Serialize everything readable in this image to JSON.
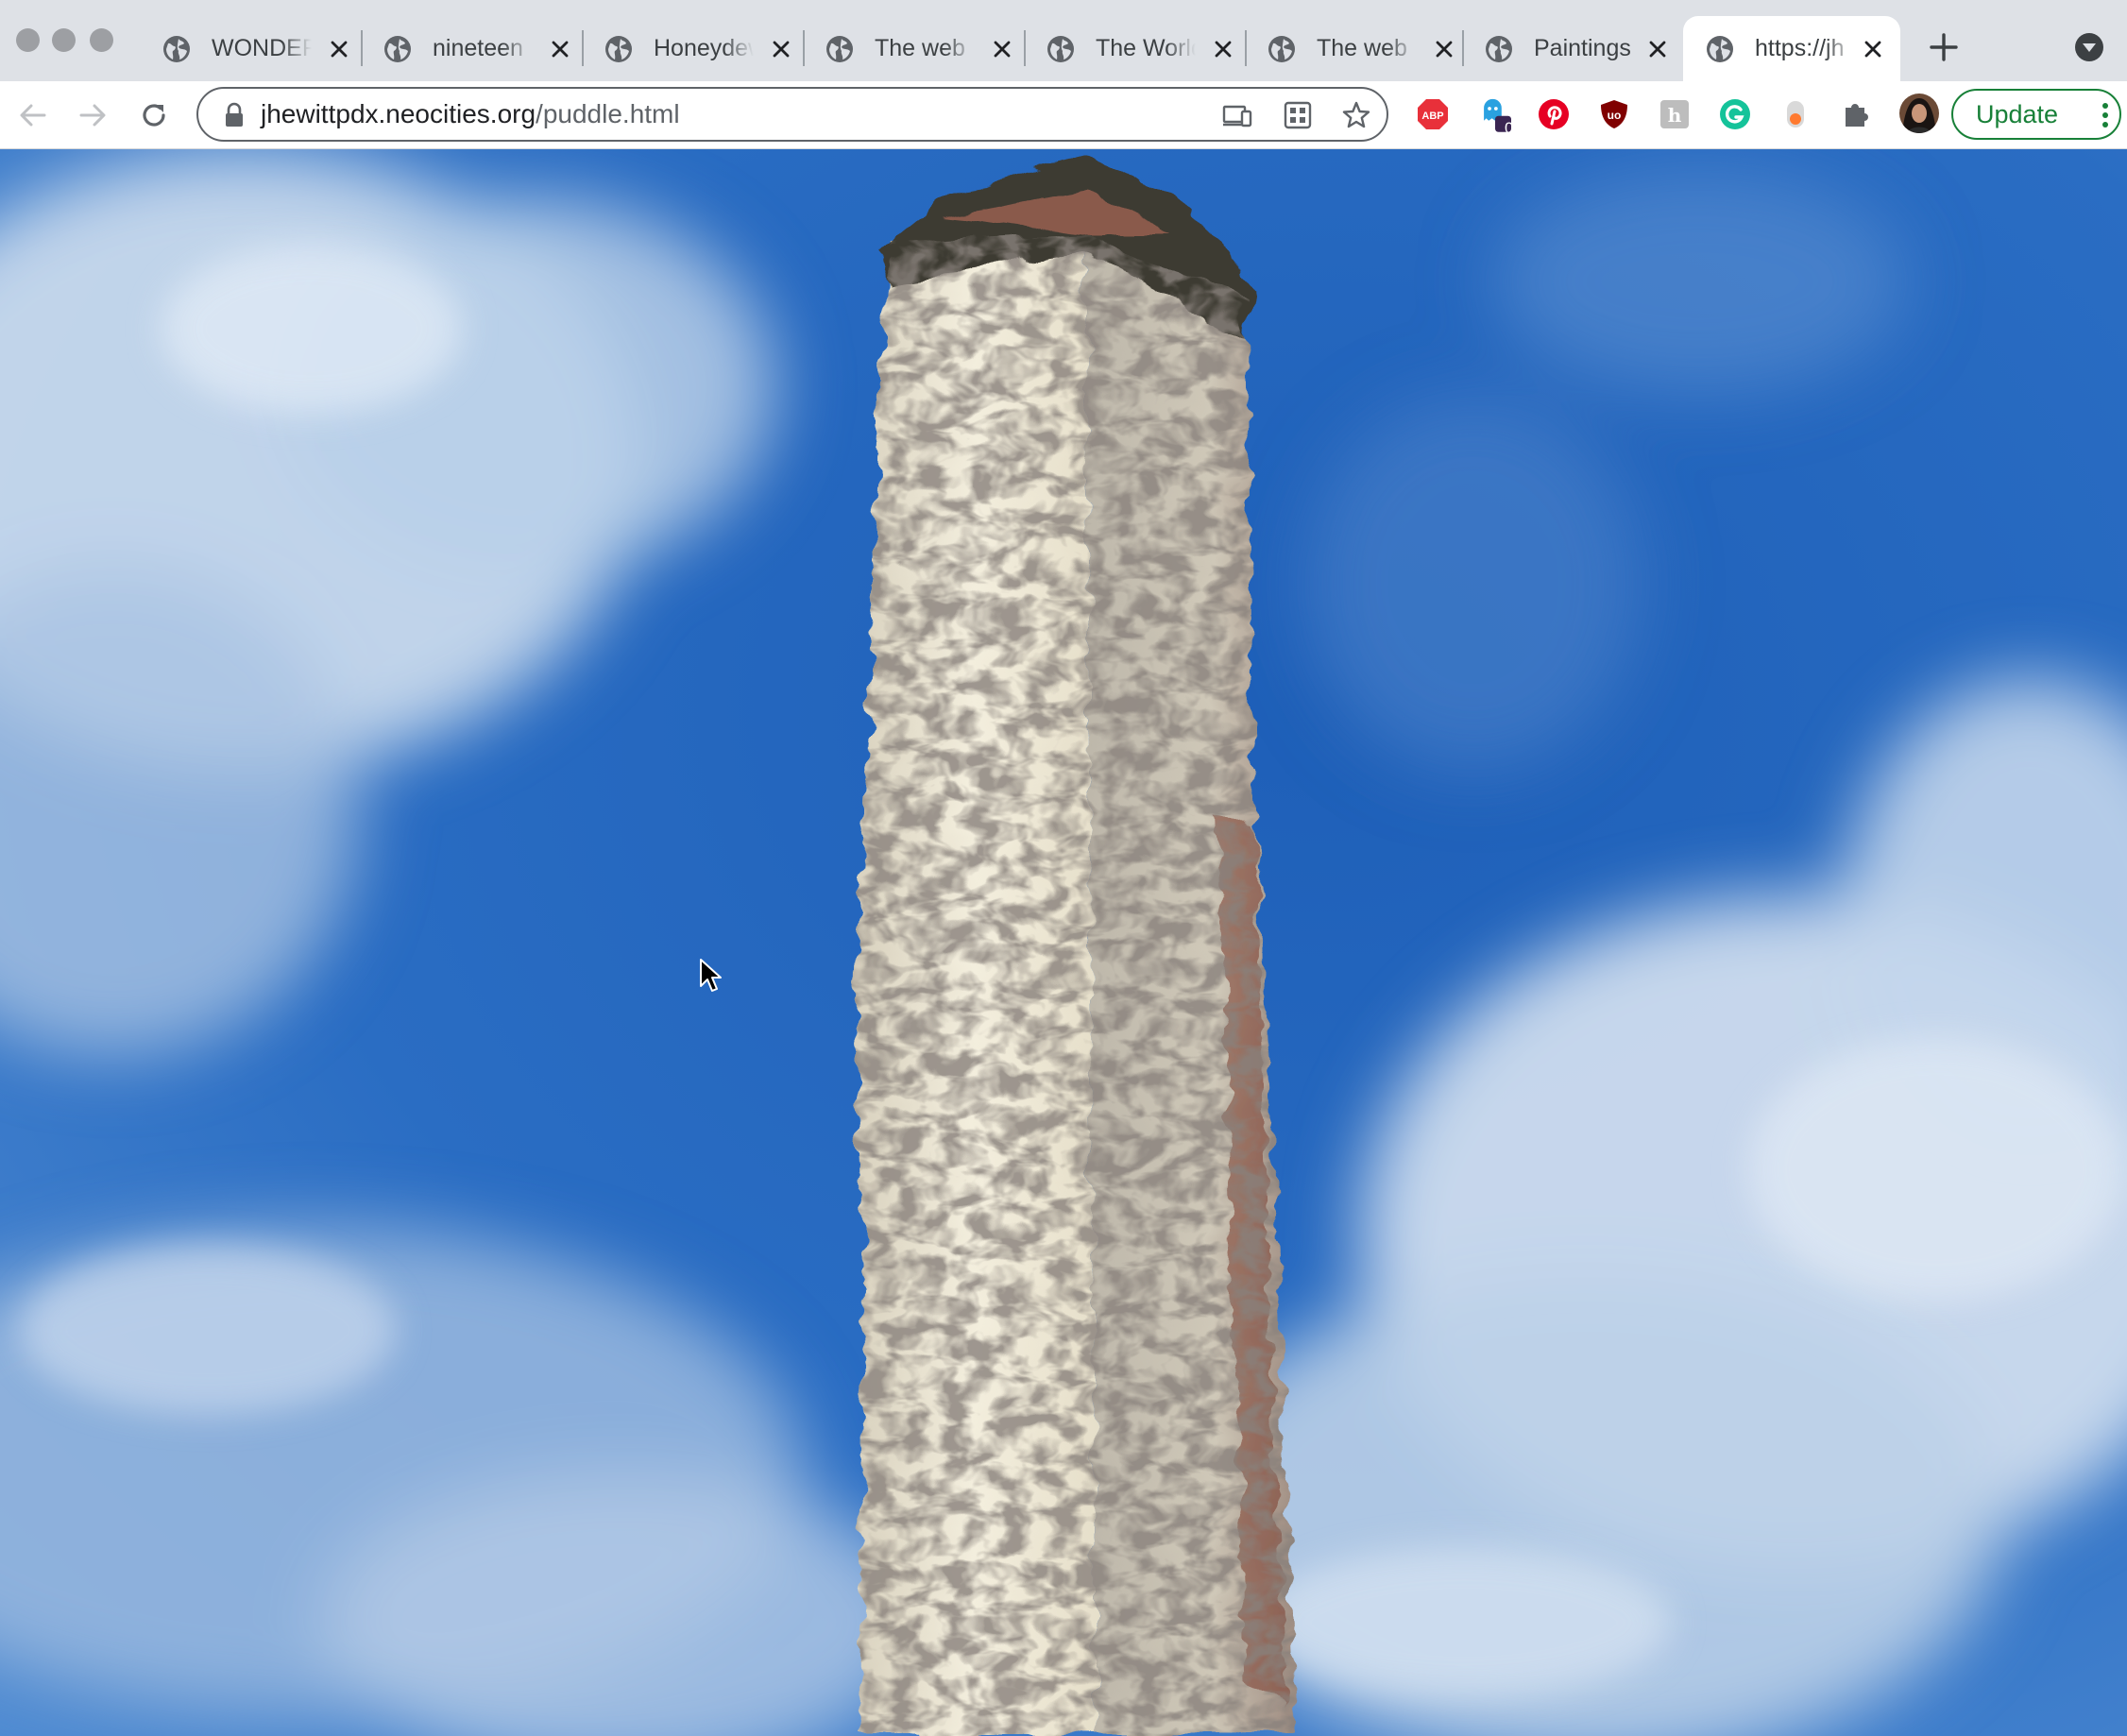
{
  "window": {
    "controls": [
      "close",
      "minimize",
      "zoom"
    ]
  },
  "tabs": [
    {
      "title": "WONDER",
      "icon": "globe-icon",
      "active": false
    },
    {
      "title": "nineteen",
      "icon": "globe-icon",
      "active": false
    },
    {
      "title": "Honeydew",
      "icon": "globe-icon",
      "active": false
    },
    {
      "title": "The web",
      "icon": "globe-icon",
      "active": false
    },
    {
      "title": "The World",
      "icon": "globe-icon",
      "active": false
    },
    {
      "title": "The web",
      "icon": "globe-icon",
      "active": false
    },
    {
      "title": "Paintings",
      "icon": "globe-icon",
      "active": false
    },
    {
      "title": "https://jh",
      "icon": "globe-icon",
      "active": true
    }
  ],
  "toolbar": {
    "url_host": "jhewittpdx.neocities.org",
    "url_path": "/puddle.html",
    "update_label": "Update",
    "extension_badge": "0"
  },
  "extensions": [
    {
      "name": "adblock-plus-icon",
      "label": "ABP",
      "color": "#e8303a"
    },
    {
      "name": "ghostery-icon",
      "color": "#2aa1e0"
    },
    {
      "name": "pinterest-icon",
      "color": "#e60023"
    },
    {
      "name": "ublock-origin-icon",
      "color": "#800000"
    },
    {
      "name": "honey-icon",
      "color": "#9e9e9e"
    },
    {
      "name": "grammarly-icon",
      "color": "#15c39a"
    },
    {
      "name": "toggl-icon",
      "color": "#ff7a30"
    },
    {
      "name": "extensions-puzzle-icon",
      "color": "#5f6368"
    }
  ],
  "colors": {
    "tabstrip": "#dee1e6",
    "sky": "#2f6fc1",
    "update": "#188038"
  }
}
